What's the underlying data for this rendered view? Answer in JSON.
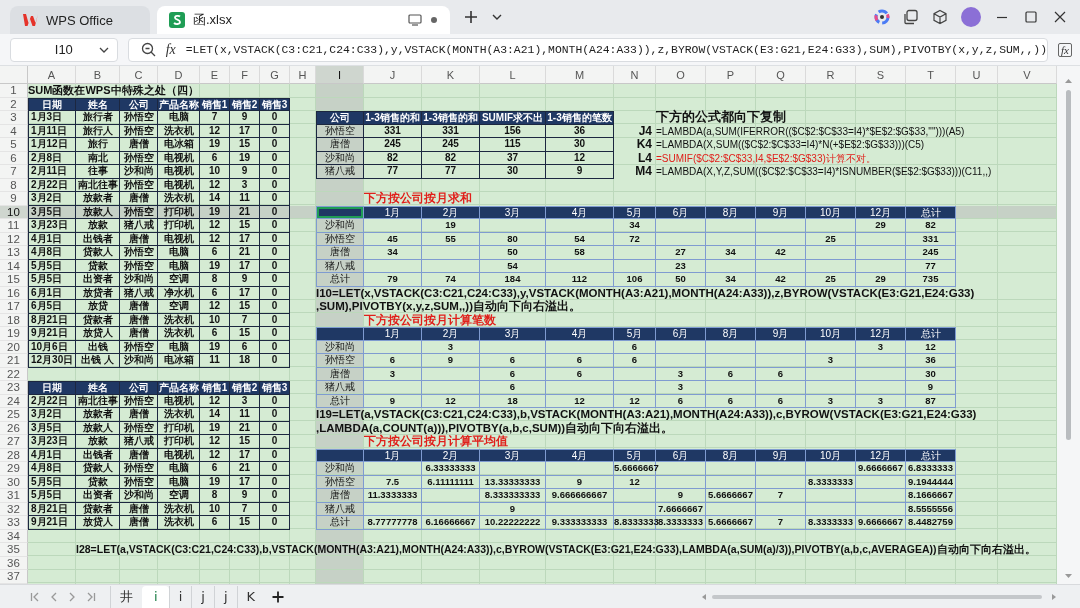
{
  "title_bar": {
    "tabs": [
      {
        "label": "WPS Office",
        "kind": "home",
        "selected": false
      },
      {
        "label": "函.xlsx",
        "kind": "sheet",
        "selected": true
      }
    ]
  },
  "formula_bar": {
    "cell_name": "I10",
    "function_button": "fx",
    "formula": "=LET(x,VSTACK(C3:C21,C24:C33),y,VSTACK(MONTH(A3:A21),MONTH(A24:A33)),z,BYROW(VSTACK(E3:G21,E24:G33),SUM),PIVOTBY(x,y,z,SUM,,))",
    "expand_button": "fx"
  },
  "column_headers": [
    {
      "label": "A",
      "selected": false
    },
    {
      "label": "B",
      "selected": false
    },
    {
      "label": "C",
      "selected": false
    },
    {
      "label": "D",
      "selected": false
    },
    {
      "label": "E",
      "selected": false
    },
    {
      "label": "F",
      "selected": false
    },
    {
      "label": "G",
      "selected": false
    },
    {
      "label": "H",
      "selected": false
    },
    {
      "label": "I",
      "selected": true
    },
    {
      "label": "J",
      "selected": false
    },
    {
      "label": "K",
      "selected": false
    },
    {
      "label": "L",
      "selected": false
    },
    {
      "label": "M",
      "selected": false
    },
    {
      "label": "N",
      "selected": false
    },
    {
      "label": "O",
      "selected": false
    },
    {
      "label": "P",
      "selected": false
    },
    {
      "label": "Q",
      "selected": false
    },
    {
      "label": "R",
      "selected": false
    },
    {
      "label": "S",
      "selected": false
    },
    {
      "label": "T",
      "selected": false
    },
    {
      "label": "U",
      "selected": false
    },
    {
      "label": "V",
      "selected": false
    }
  ],
  "row_numbers": [
    {
      "label": "1",
      "selected": false
    },
    {
      "label": "2",
      "selected": false
    },
    {
      "label": "3",
      "selected": false
    },
    {
      "label": "4",
      "selected": false
    },
    {
      "label": "5",
      "selected": false
    },
    {
      "label": "6",
      "selected": false
    },
    {
      "label": "7",
      "selected": false
    },
    {
      "label": "8",
      "selected": false
    },
    {
      "label": "9",
      "selected": false
    },
    {
      "label": "10",
      "selected": true
    },
    {
      "label": "11",
      "selected": false
    },
    {
      "label": "12",
      "selected": false
    },
    {
      "label": "13",
      "selected": false
    },
    {
      "label": "14",
      "selected": false
    },
    {
      "label": "15",
      "selected": false
    },
    {
      "label": "16",
      "selected": false
    },
    {
      "label": "17",
      "selected": false
    },
    {
      "label": "18",
      "selected": false
    },
    {
      "label": "19",
      "selected": false
    },
    {
      "label": "20",
      "selected": false
    },
    {
      "label": "21",
      "selected": false
    },
    {
      "label": "22",
      "selected": false
    },
    {
      "label": "23",
      "selected": false
    },
    {
      "label": "24",
      "selected": false
    },
    {
      "label": "25",
      "selected": false
    },
    {
      "label": "26",
      "selected": false
    },
    {
      "label": "27",
      "selected": false
    },
    {
      "label": "28",
      "selected": false
    },
    {
      "label": "29",
      "selected": false
    },
    {
      "label": "30",
      "selected": false
    },
    {
      "label": "31",
      "selected": false
    },
    {
      "label": "32",
      "selected": false
    },
    {
      "label": "33",
      "selected": false
    },
    {
      "label": "34",
      "selected": false
    },
    {
      "label": "35",
      "selected": false
    },
    {
      "label": "36",
      "selected": false
    },
    {
      "label": "37",
      "selected": false
    }
  ],
  "sheet": {
    "title": "SUM函数在WPS中特殊之处（四）",
    "source_tables": [
      {
        "columns": [
          "日期",
          "姓名",
          "公司",
          "产品名称",
          "销售1",
          "销售2",
          "销售3"
        ],
        "rows": [
          [
            "1月3日",
            "旅行者",
            "孙悟空",
            "电脑",
            "7",
            "9",
            "0"
          ],
          [
            "1月11日",
            "旅行人",
            "孙悟空",
            "洗衣机",
            "12",
            "17",
            "0"
          ],
          [
            "1月12日",
            "旅行",
            "唐僧",
            "电冰箱",
            "19",
            "15",
            "0"
          ],
          [
            "2月8日",
            "南北",
            "孙悟空",
            "电视机",
            "6",
            "19",
            "0"
          ],
          [
            "2月11日",
            "往事",
            "沙和尚",
            "电视机",
            "10",
            "9",
            "0"
          ],
          [
            "2月22日",
            "南北往事",
            "孙悟空",
            "电视机",
            "12",
            "3",
            "0"
          ],
          [
            "3月2日",
            "放款者",
            "唐僧",
            "洗衣机",
            "14",
            "11",
            "0"
          ],
          [
            "3月5日",
            "放款人",
            "孙悟空",
            "打印机",
            "19",
            "21",
            "0"
          ],
          [
            "3月23日",
            "放款",
            "猪八戒",
            "打印机",
            "12",
            "15",
            "0"
          ],
          [
            "4月1日",
            "出钱者",
            "唐僧",
            "电视机",
            "12",
            "17",
            "0"
          ],
          [
            "4月8日",
            "贷款人",
            "孙悟空",
            "电脑",
            "6",
            "21",
            "0"
          ],
          [
            "5月5日",
            "贷款",
            "孙悟空",
            "电脑",
            "19",
            "17",
            "0"
          ],
          [
            "5月5日",
            "出资者",
            "沙和尚",
            "空调",
            "8",
            "9",
            "0"
          ],
          [
            "6月1日",
            "放贷者",
            "猪八戒",
            "净水机",
            "6",
            "17",
            "0"
          ],
          [
            "6月5日",
            "放贷",
            "唐僧",
            "空调",
            "12",
            "15",
            "0"
          ],
          [
            "8月21日",
            "贷款者",
            "唐僧",
            "洗衣机",
            "10",
            "7",
            "0"
          ],
          [
            "9月21日",
            "放贷人",
            "唐僧",
            "洗衣机",
            "6",
            "15",
            "0"
          ],
          [
            "10月6日",
            "出钱",
            "孙悟空",
            "电脑",
            "19",
            "6",
            "0"
          ],
          [
            "12月30日",
            "出钱 人",
            "沙和尚",
            "电冰箱",
            "11",
            "18",
            "0"
          ]
        ]
      },
      {
        "columns": [
          "日期",
          "姓名",
          "公司",
          "产品名称",
          "销售1",
          "销售2",
          "销售3"
        ],
        "rows": [
          [
            "2月22日",
            "南北往事",
            "孙悟空",
            "电视机",
            "12",
            "3",
            "0"
          ],
          [
            "3月2日",
            "放款者",
            "唐僧",
            "洗衣机",
            "14",
            "11",
            "0"
          ],
          [
            "3月5日",
            "放款人",
            "孙悟空",
            "打印机",
            "19",
            "21",
            "0"
          ],
          [
            "3月23日",
            "放款",
            "猪八戒",
            "打印机",
            "12",
            "15",
            "0"
          ],
          [
            "4月1日",
            "出钱者",
            "唐僧",
            "电视机",
            "12",
            "17",
            "0"
          ],
          [
            "4月8日",
            "贷款人",
            "孙悟空",
            "电脑",
            "6",
            "21",
            "0"
          ],
          [
            "5月5日",
            "贷款",
            "孙悟空",
            "电脑",
            "19",
            "17",
            "0"
          ],
          [
            "5月5日",
            "出资者",
            "沙和尚",
            "空调",
            "8",
            "9",
            "0"
          ],
          [
            "8月21日",
            "贷款者",
            "唐僧",
            "洗衣机",
            "10",
            "7",
            "0"
          ],
          [
            "9月21日",
            "放贷人",
            "唐僧",
            "洗衣机",
            "6",
            "15",
            "0"
          ]
        ]
      }
    ],
    "summary_table": {
      "columns": [
        "公司",
        "1-3销售的和",
        "1-3销售的和",
        "SUMIF求不出",
        "1-3销售的笔数"
      ],
      "rows": [
        [
          "孙悟空",
          "331",
          "331",
          "156",
          "36"
        ],
        [
          "唐僧",
          "245",
          "245",
          "115",
          "30"
        ],
        [
          "沙和尚",
          "82",
          "82",
          "37",
          "12"
        ],
        [
          "猪八戒",
          "77",
          "77",
          "30",
          "9"
        ]
      ]
    },
    "formula_notes": {
      "heading": "下方的公式都向下复制",
      "items": [
        {
          "cell": "J4",
          "formula": "=LAMBDA(a,SUM(IFERROR(($C$2:$C$33=I4)*$E$2:$G$33,\"\")))(A5)",
          "kind": "normal"
        },
        {
          "cell": "K4",
          "formula": "=LAMBDA(X,SUM(($C$2:$C$33=I4)*N(+$E$2:$G$33)))(C5)",
          "kind": "normal"
        },
        {
          "cell": "L4",
          "formula": "=SUMIF($C$2:$C$33,I4,$E$2:$G$33)计算不对。",
          "kind": "warning"
        },
        {
          "cell": "M4",
          "formula": "=LAMBDA(X,Y,Z,SUM(($C$2:$C$33=I4)*ISNUMBER($E$2:$G$33)))(C11,,)",
          "kind": "normal"
        }
      ]
    },
    "pivot_tables": [
      {
        "heading": "下方按公司按月求和",
        "corner_selected": true,
        "columns": [
          "1月",
          "2月",
          "3月",
          "4月",
          "5月",
          "6月",
          "8月",
          "9月",
          "10月",
          "12月",
          "总计"
        ],
        "rows": [
          {
            "label": "沙和尚",
            "cells": [
              {
                "kind": "blank"
              },
              {
                "kind": "number",
                "text": "19"
              },
              {
                "kind": "blank"
              },
              {
                "kind": "blank"
              },
              {
                "kind": "number",
                "text": "34"
              },
              {
                "kind": "blank"
              },
              {
                "kind": "blank"
              },
              {
                "kind": "blank"
              },
              {
                "kind": "blank"
              },
              {
                "kind": "number",
                "text": "29"
              },
              {
                "kind": "number",
                "text": "82"
              }
            ]
          },
          {
            "label": "孙悟空",
            "cells": [
              {
                "kind": "number",
                "text": "45"
              },
              {
                "kind": "number",
                "text": "55"
              },
              {
                "kind": "number",
                "text": "80"
              },
              {
                "kind": "number",
                "text": "54"
              },
              {
                "kind": "number",
                "text": "72"
              },
              {
                "kind": "blank"
              },
              {
                "kind": "blank"
              },
              {
                "kind": "blank"
              },
              {
                "kind": "number",
                "text": "25"
              },
              {
                "kind": "blank"
              },
              {
                "kind": "number",
                "text": "331"
              }
            ]
          },
          {
            "label": "唐僧",
            "cells": [
              {
                "kind": "number",
                "text": "34"
              },
              {
                "kind": "blank"
              },
              {
                "kind": "number",
                "text": "50"
              },
              {
                "kind": "number",
                "text": "58"
              },
              {
                "kind": "blank"
              },
              {
                "kind": "number",
                "text": "27"
              },
              {
                "kind": "number",
                "text": "34"
              },
              {
                "kind": "number",
                "text": "42"
              },
              {
                "kind": "blank"
              },
              {
                "kind": "blank"
              },
              {
                "kind": "number",
                "text": "245"
              }
            ]
          },
          {
            "label": "猪八戒",
            "cells": [
              {
                "kind": "blank"
              },
              {
                "kind": "blank"
              },
              {
                "kind": "number",
                "text": "54"
              },
              {
                "kind": "blank"
              },
              {
                "kind": "blank"
              },
              {
                "kind": "number",
                "text": "23"
              },
              {
                "kind": "blank"
              },
              {
                "kind": "blank"
              },
              {
                "kind": "blank"
              },
              {
                "kind": "blank"
              },
              {
                "kind": "number",
                "text": "77"
              }
            ]
          },
          {
            "label": "总计",
            "cells": [
              {
                "kind": "number",
                "text": "79"
              },
              {
                "kind": "number",
                "text": "74"
              },
              {
                "kind": "number",
                "text": "184"
              },
              {
                "kind": "number",
                "text": "112"
              },
              {
                "kind": "number",
                "text": "106"
              },
              {
                "kind": "number",
                "text": "50"
              },
              {
                "kind": "number",
                "text": "34"
              },
              {
                "kind": "number",
                "text": "42"
              },
              {
                "kind": "number",
                "text": "25"
              },
              {
                "kind": "number",
                "text": "29"
              },
              {
                "kind": "number",
                "text": "735"
              }
            ]
          }
        ],
        "formula_lines": [
          "I10=LET(x,VSTACK(C3:C21,C24:C33),y,VSTACK(MONTH(A3:A21),MONTH(A24:A33)),z,BYROW(VSTACK(E3:G21,E24:G33)",
          ",SUM),PIVOTBY(x,y,z,SUM,,))自动向下向右溢出。"
        ]
      },
      {
        "heading": "下方按公司按月计算笔数",
        "corner_selected": false,
        "columns": [
          "1月",
          "2月",
          "3月",
          "4月",
          "5月",
          "6月",
          "8月",
          "9月",
          "10月",
          "12月",
          "总计"
        ],
        "rows": [
          {
            "label": "沙和尚",
            "cells": [
              {
                "kind": "blank"
              },
              {
                "kind": "number",
                "text": "3"
              },
              {
                "kind": "blank"
              },
              {
                "kind": "blank"
              },
              {
                "kind": "number",
                "text": "6"
              },
              {
                "kind": "blank"
              },
              {
                "kind": "blank"
              },
              {
                "kind": "blank"
              },
              {
                "kind": "blank"
              },
              {
                "kind": "number",
                "text": "3"
              },
              {
                "kind": "number",
                "text": "12"
              }
            ]
          },
          {
            "label": "孙悟空",
            "cells": [
              {
                "kind": "number",
                "text": "6"
              },
              {
                "kind": "number",
                "text": "9"
              },
              {
                "kind": "number",
                "text": "6"
              },
              {
                "kind": "number",
                "text": "6"
              },
              {
                "kind": "number",
                "text": "6"
              },
              {
                "kind": "blank"
              },
              {
                "kind": "blank"
              },
              {
                "kind": "blank"
              },
              {
                "kind": "number",
                "text": "3"
              },
              {
                "kind": "blank"
              },
              {
                "kind": "number",
                "text": "36"
              }
            ]
          },
          {
            "label": "唐僧",
            "cells": [
              {
                "kind": "number",
                "text": "3"
              },
              {
                "kind": "blank"
              },
              {
                "kind": "number",
                "text": "6"
              },
              {
                "kind": "number",
                "text": "6"
              },
              {
                "kind": "blank"
              },
              {
                "kind": "number",
                "text": "3"
              },
              {
                "kind": "number",
                "text": "6"
              },
              {
                "kind": "number",
                "text": "6"
              },
              {
                "kind": "blank"
              },
              {
                "kind": "blank"
              },
              {
                "kind": "number",
                "text": "30"
              }
            ]
          },
          {
            "label": "猪八戒",
            "cells": [
              {
                "kind": "blank"
              },
              {
                "kind": "blank"
              },
              {
                "kind": "number",
                "text": "6"
              },
              {
                "kind": "blank"
              },
              {
                "kind": "blank"
              },
              {
                "kind": "number",
                "text": "3"
              },
              {
                "kind": "blank"
              },
              {
                "kind": "blank"
              },
              {
                "kind": "blank"
              },
              {
                "kind": "blank"
              },
              {
                "kind": "number",
                "text": "9"
              }
            ]
          },
          {
            "label": "总计",
            "cells": [
              {
                "kind": "number",
                "text": "9"
              },
              {
                "kind": "number",
                "text": "12"
              },
              {
                "kind": "number",
                "text": "18"
              },
              {
                "kind": "number",
                "text": "12"
              },
              {
                "kind": "number",
                "text": "12"
              },
              {
                "kind": "number",
                "text": "6"
              },
              {
                "kind": "number",
                "text": "6"
              },
              {
                "kind": "number",
                "text": "6"
              },
              {
                "kind": "number",
                "text": "3"
              },
              {
                "kind": "number",
                "text": "3"
              },
              {
                "kind": "number",
                "text": "87"
              }
            ]
          }
        ],
        "formula_lines": [
          "I19=LET(a,VSTACK(C3:C21,C24:C33),b,VSTACK(MONTH(A3:A21),MONTH(A24:A33)),c,BYROW(VSTACK(E3:G21,E24:G33)",
          ",LAMBDA(a,COUNT(a))),PIVOTBY(a,b,c,SUM))自动向下向右溢出。"
        ]
      },
      {
        "heading": "下方按公司按月计算平均值",
        "corner_selected": false,
        "columns": [
          "1月",
          "2月",
          "3月",
          "4月",
          "5月",
          "6月",
          "8月",
          "9月",
          "10月",
          "12月",
          "总计"
        ],
        "rows": [
          {
            "label": "沙和尚",
            "cells": [
              {
                "kind": "blank"
              },
              {
                "kind": "number",
                "text": "6.33333333"
              },
              {
                "kind": "blank"
              },
              {
                "kind": "blank"
              },
              {
                "kind": "number",
                "text": "5.6666667"
              },
              {
                "kind": "blank"
              },
              {
                "kind": "blank"
              },
              {
                "kind": "blank"
              },
              {
                "kind": "blank"
              },
              {
                "kind": "number",
                "text": "9.6666667"
              },
              {
                "kind": "number",
                "text": "6.8333333"
              }
            ]
          },
          {
            "label": "孙悟空",
            "cells": [
              {
                "kind": "number",
                "text": "7.5"
              },
              {
                "kind": "number",
                "text": "6.11111111"
              },
              {
                "kind": "number",
                "text": "13.33333333"
              },
              {
                "kind": "number",
                "text": "9"
              },
              {
                "kind": "number",
                "text": "12"
              },
              {
                "kind": "blank"
              },
              {
                "kind": "blank"
              },
              {
                "kind": "blank"
              },
              {
                "kind": "number",
                "text": "8.3333333"
              },
              {
                "kind": "blank"
              },
              {
                "kind": "number",
                "text": "9.1944444"
              }
            ]
          },
          {
            "label": "唐僧",
            "cells": [
              {
                "kind": "number",
                "text": "11.3333333"
              },
              {
                "kind": "blank"
              },
              {
                "kind": "number",
                "text": "8.333333333"
              },
              {
                "kind": "number",
                "text": "9.666666667"
              },
              {
                "kind": "blank"
              },
              {
                "kind": "number",
                "text": "9"
              },
              {
                "kind": "number",
                "text": "5.6666667"
              },
              {
                "kind": "number",
                "text": "7"
              },
              {
                "kind": "blank"
              },
              {
                "kind": "blank"
              },
              {
                "kind": "number",
                "text": "8.1666667"
              }
            ]
          },
          {
            "label": "猪八戒",
            "cells": [
              {
                "kind": "blank"
              },
              {
                "kind": "blank"
              },
              {
                "kind": "number",
                "text": "9"
              },
              {
                "kind": "blank"
              },
              {
                "kind": "blank"
              },
              {
                "kind": "number",
                "text": "7.6666667"
              },
              {
                "kind": "blank"
              },
              {
                "kind": "blank"
              },
              {
                "kind": "blank"
              },
              {
                "kind": "blank"
              },
              {
                "kind": "number",
                "text": "8.5555556"
              }
            ]
          },
          {
            "label": "总计",
            "cells": [
              {
                "kind": "number",
                "text": "8.77777778"
              },
              {
                "kind": "number",
                "text": "6.16666667"
              },
              {
                "kind": "number",
                "text": "10.22222222"
              },
              {
                "kind": "number",
                "text": "9.333333333"
              },
              {
                "kind": "number",
                "text": "8.8333333"
              },
              {
                "kind": "number",
                "text": "8.3333333"
              },
              {
                "kind": "number",
                "text": "5.6666667"
              },
              {
                "kind": "number",
                "text": "7"
              },
              {
                "kind": "number",
                "text": "8.3333333"
              },
              {
                "kind": "number",
                "text": "9.6666667"
              },
              {
                "kind": "number",
                "text": "8.4482759"
              }
            ]
          }
        ],
        "formula_lines": [
          "I28=LET(a,VSTACK(C3:C21,C24:C33),b,VSTACK(MONTH(A3:A21),MONTH(A24:A33)),c,BYROW(VSTACK(E3:G21,E24:G33),LAMBDA(a,SUM(a)/3)),PIVOTBY(a,b,c,AVERAGEA))自动向下向右溢出。"
        ]
      }
    ]
  },
  "sheet_tabs": [
    {
      "label": "井",
      "selected": false
    },
    {
      "label": "i",
      "selected": true
    },
    {
      "label": "i",
      "selected": false
    },
    {
      "label": "j",
      "selected": false
    },
    {
      "label": "j",
      "selected": false
    },
    {
      "label": "K",
      "selected": false
    }
  ]
}
